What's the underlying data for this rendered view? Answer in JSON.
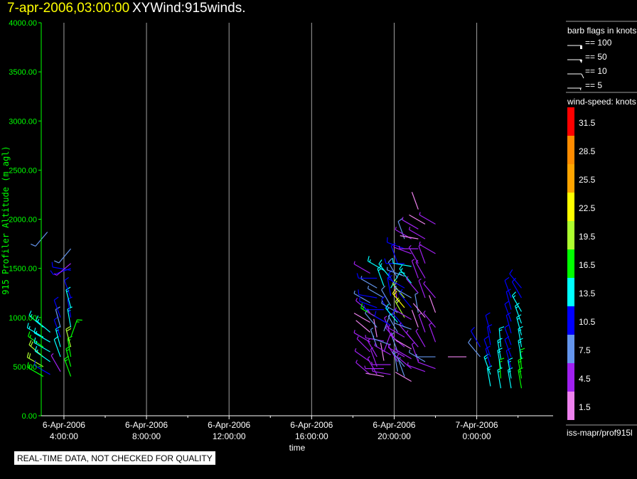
{
  "header": {
    "date": "7-apr-2006,03:00:00",
    "title": "XYWind:915winds."
  },
  "quality_notice": "REAL-TIME DATA, NOT CHECKED FOR QUALITY",
  "legend": {
    "barb_title": "barb flags in knots",
    "barb_items": [
      {
        "label": "== 100",
        "knots": 100
      },
      {
        "label": "== 50",
        "knots": 50
      },
      {
        "label": "== 10",
        "knots": 10
      },
      {
        "label": "== 5",
        "knots": 5
      }
    ],
    "speed_title": "wind-speed: knots",
    "speed_bins": [
      {
        "label": "31.5",
        "color": "#ff0000"
      },
      {
        "label": "28.5",
        "color": "#ff8c00"
      },
      {
        "label": "25.5",
        "color": "#ffa500"
      },
      {
        "label": "22.5",
        "color": "#ffff00"
      },
      {
        "label": "19.5",
        "color": "#adff2f"
      },
      {
        "label": "16.5",
        "color": "#00ff00"
      },
      {
        "label": "13.5",
        "color": "#00ffff"
      },
      {
        "label": "10.5",
        "color": "#0000ff"
      },
      {
        "label": "7.5",
        "color": "#6495ed"
      },
      {
        "label": "4.5",
        "color": "#a020f0"
      },
      {
        "label": "1.5",
        "color": "#ee82ee"
      }
    ],
    "source": "iss-mapr/prof915l"
  },
  "chart_data": {
    "type": "wind-barb",
    "xlabel": "time",
    "ylabel": "915 Profiler Altitude (m agl)",
    "xlim": [
      "2006-04-06 02:54",
      "2006-04-07 03:42"
    ],
    "ylim": [
      0,
      4000
    ],
    "yticks": [
      "0.00",
      "500.00",
      "1000.00",
      "1500.00",
      "2000.00",
      "2500.00",
      "3000.00",
      "3500.00",
      "4000.00"
    ],
    "xticks": [
      {
        "date": "6-Apr-2006",
        "time": "4:00:00",
        "at": "2006-04-06 04:00"
      },
      {
        "date": "6-Apr-2006",
        "time": "8:00:00",
        "at": "2006-04-06 08:00"
      },
      {
        "date": "6-Apr-2006",
        "time": "12:00:00",
        "at": "2006-04-06 12:00"
      },
      {
        "date": "6-Apr-2006",
        "time": "16:00:00",
        "at": "2006-04-06 16:00"
      },
      {
        "date": "6-Apr-2006",
        "time": "20:00:00",
        "at": "2006-04-06 20:00"
      },
      {
        "date": "7-Apr-2006",
        "time": "0:00:00",
        "at": "2006-04-07 00:00"
      }
    ],
    "grid": "vertical at major ticks",
    "colors": {
      "axis_y": "#00ff00",
      "axis_x": "#ffffff",
      "grid": "#a0a0a0"
    },
    "profiles": [
      {
        "time": "2006-04-06 03:00",
        "obs": [
          [
            400,
            300,
            16
          ],
          [
            500,
            300,
            18
          ],
          [
            600,
            310,
            20
          ],
          [
            700,
            305,
            15
          ],
          [
            800,
            300,
            14
          ],
          [
            900,
            310,
            13
          ]
        ]
      },
      {
        "time": "2006-04-06 03:12",
        "obs": [
          [
            1870,
            220,
            8
          ]
        ]
      },
      {
        "time": "2006-04-06 03:20",
        "obs": [
          [
            420,
            300,
            11
          ],
          [
            550,
            305,
            13
          ],
          [
            650,
            300,
            13
          ],
          [
            750,
            300,
            13
          ],
          [
            850,
            310,
            13
          ]
        ]
      },
      {
        "time": "2006-04-06 03:50",
        "obs": [
          [
            450,
            330,
            5
          ],
          [
            600,
            340,
            12
          ],
          [
            700,
            345,
            13
          ],
          [
            800,
            340,
            10
          ],
          [
            900,
            345,
            8
          ],
          [
            1000,
            340,
            10
          ]
        ]
      },
      {
        "time": "2006-04-06 04:20",
        "obs": [
          [
            400,
            340,
            17
          ],
          [
            500,
            345,
            17
          ],
          [
            600,
            350,
            16
          ],
          [
            700,
            345,
            19
          ],
          [
            800,
            20,
            15
          ],
          [
            900,
            350,
            14
          ],
          [
            1000,
            350,
            11
          ],
          [
            1100,
            345,
            13
          ],
          [
            1200,
            340,
            10
          ],
          [
            1480,
            280,
            11
          ],
          [
            1500,
            250,
            10
          ],
          [
            1550,
            230,
            5
          ],
          [
            1700,
            220,
            8
          ]
        ]
      },
      {
        "time": "2006-04-06 18:50",
        "obs": [
          [
            420,
            310,
            5
          ],
          [
            550,
            305,
            4
          ],
          [
            650,
            315,
            3
          ],
          [
            750,
            300,
            4
          ],
          [
            850,
            310,
            2
          ],
          [
            950,
            300,
            2
          ],
          [
            1050,
            310,
            3
          ],
          [
            1150,
            300,
            7
          ],
          [
            1450,
            300,
            5
          ]
        ]
      },
      {
        "time": "2006-04-06 19:10",
        "obs": [
          [
            420,
            330,
            3
          ],
          [
            500,
            340,
            4
          ],
          [
            600,
            330,
            4
          ],
          [
            700,
            340,
            6
          ],
          [
            800,
            350,
            2
          ],
          [
            900,
            320,
            8
          ],
          [
            1000,
            300,
            16
          ],
          [
            1100,
            290,
            10
          ],
          [
            1200,
            280,
            9
          ],
          [
            1300,
            300,
            7
          ],
          [
            1400,
            270,
            10
          ]
        ]
      },
      {
        "time": "2006-04-06 19:30",
        "obs": [
          [
            400,
            280,
            2
          ],
          [
            480,
            270,
            4
          ],
          [
            560,
            350,
            2
          ],
          [
            650,
            20,
            4
          ],
          [
            760,
            280,
            3
          ],
          [
            860,
            20,
            7
          ],
          [
            960,
            300,
            4
          ],
          [
            1080,
            270,
            10
          ],
          [
            1200,
            300,
            7
          ],
          [
            1320,
            340,
            13
          ],
          [
            1480,
            300,
            14
          ]
        ]
      },
      {
        "time": "2006-04-06 19:50",
        "obs": [
          [
            420,
            280,
            3
          ],
          [
            520,
            270,
            4
          ],
          [
            620,
            300,
            5
          ],
          [
            720,
            290,
            6
          ],
          [
            820,
            340,
            4
          ],
          [
            920,
            300,
            9
          ],
          [
            1020,
            330,
            10
          ],
          [
            1120,
            330,
            8
          ],
          [
            1220,
            350,
            10
          ],
          [
            1300,
            30,
            14
          ],
          [
            1400,
            320,
            13
          ]
        ]
      },
      {
        "time": "2006-04-06 20:10",
        "obs": [
          [
            450,
            350,
            7
          ],
          [
            550,
            330,
            5
          ],
          [
            650,
            340,
            6
          ],
          [
            750,
            320,
            4
          ],
          [
            850,
            330,
            7
          ],
          [
            950,
            320,
            13
          ],
          [
            1050,
            300,
            7
          ],
          [
            1150,
            350,
            4
          ],
          [
            1280,
            330,
            11
          ],
          [
            1400,
            330,
            8
          ],
          [
            1550,
            340,
            10
          ]
        ]
      },
      {
        "time": "2006-04-06 20:30",
        "obs": [
          [
            400,
            340,
            6
          ],
          [
            500,
            320,
            7
          ],
          [
            600,
            300,
            5
          ],
          [
            700,
            310,
            3
          ],
          [
            800,
            300,
            4
          ],
          [
            900,
            320,
            10
          ],
          [
            1000,
            330,
            18
          ],
          [
            1100,
            320,
            22
          ],
          [
            1200,
            320,
            20
          ],
          [
            1300,
            300,
            11
          ],
          [
            1420,
            290,
            7
          ],
          [
            1550,
            270,
            9
          ],
          [
            1700,
            290,
            10
          ],
          [
            1800,
            340,
            8
          ]
        ]
      },
      {
        "time": "2006-04-06 20:50",
        "obs": [
          [
            350,
            300,
            2
          ],
          [
            480,
            310,
            4
          ],
          [
            580,
            300,
            3
          ],
          [
            680,
            300,
            2
          ],
          [
            780,
            320,
            4
          ],
          [
            880,
            290,
            6
          ],
          [
            980,
            300,
            4
          ],
          [
            1100,
            320,
            10
          ],
          [
            1200,
            300,
            7
          ],
          [
            1350,
            320,
            13
          ],
          [
            1520,
            280,
            12
          ],
          [
            1650,
            290,
            3
          ],
          [
            1800,
            300,
            4
          ]
        ]
      },
      {
        "time": "2006-04-06 21:10",
        "obs": [
          [
            550,
            340,
            4
          ],
          [
            700,
            320,
            3
          ],
          [
            900,
            340,
            2
          ],
          [
            1050,
            350,
            7
          ],
          [
            1250,
            320,
            4
          ],
          [
            1400,
            340,
            3
          ],
          [
            1550,
            330,
            4
          ],
          [
            1700,
            270,
            3
          ],
          [
            1800,
            280,
            2
          ],
          [
            1900,
            300,
            3
          ],
          [
            2100,
            340,
            2
          ]
        ]
      },
      {
        "time": "2006-04-06 21:30",
        "obs": [
          [
            450,
            290,
            4
          ],
          [
            550,
            300,
            7
          ],
          [
            700,
            330,
            4
          ],
          [
            850,
            340,
            3
          ],
          [
            1000,
            320,
            2
          ],
          [
            1200,
            340,
            3
          ],
          [
            1400,
            330,
            4
          ],
          [
            1550,
            340,
            3
          ],
          [
            1800,
            300,
            4
          ],
          [
            1950,
            300,
            2
          ]
        ]
      },
      {
        "time": "2006-04-06 22:00",
        "obs": [
          [
            480,
            290,
            4
          ],
          [
            600,
            270,
            7
          ],
          [
            750,
            340,
            3
          ],
          [
            900,
            320,
            4
          ],
          [
            1050,
            340,
            2
          ],
          [
            1200,
            320,
            3
          ],
          [
            1650,
            300,
            3
          ],
          [
            1950,
            300,
            3
          ]
        ]
      },
      {
        "time": "2006-04-06 23:30",
        "obs": [
          [
            600,
            270,
            2
          ]
        ]
      },
      {
        "time": "2006-04-07 00:10",
        "obs": [
          [
            600,
            320,
            8
          ],
          [
            700,
            330,
            9
          ]
        ]
      },
      {
        "time": "2006-04-07 00:40",
        "obs": [
          [
            300,
            350,
            14
          ],
          [
            420,
            340,
            13
          ],
          [
            500,
            345,
            11
          ],
          [
            600,
            340,
            11
          ],
          [
            720,
            350,
            10
          ],
          [
            840,
            345,
            11
          ]
        ]
      },
      {
        "time": "2006-04-07 01:10",
        "obs": [
          [
            280,
            350,
            14
          ],
          [
            380,
            355,
            17
          ],
          [
            480,
            350,
            14
          ],
          [
            580,
            350,
            14
          ],
          [
            700,
            355,
            13
          ]
        ]
      },
      {
        "time": "2006-04-07 01:40",
        "obs": [
          [
            280,
            350,
            13
          ],
          [
            380,
            350,
            13
          ],
          [
            480,
            345,
            11
          ],
          [
            600,
            340,
            10
          ],
          [
            720,
            340,
            11
          ],
          [
            840,
            345,
            10
          ],
          [
            960,
            340,
            10
          ],
          [
            1080,
            345,
            11
          ],
          [
            1200,
            340,
            10
          ]
        ]
      },
      {
        "time": "2006-04-07 02:10",
        "obs": [
          [
            280,
            350,
            16
          ],
          [
            380,
            350,
            17
          ],
          [
            480,
            355,
            16
          ],
          [
            580,
            350,
            14
          ],
          [
            700,
            350,
            14
          ],
          [
            820,
            345,
            13
          ],
          [
            940,
            340,
            13
          ],
          [
            1060,
            330,
            13
          ],
          [
            1200,
            330,
            10
          ],
          [
            1300,
            320,
            10
          ]
        ]
      }
    ]
  }
}
